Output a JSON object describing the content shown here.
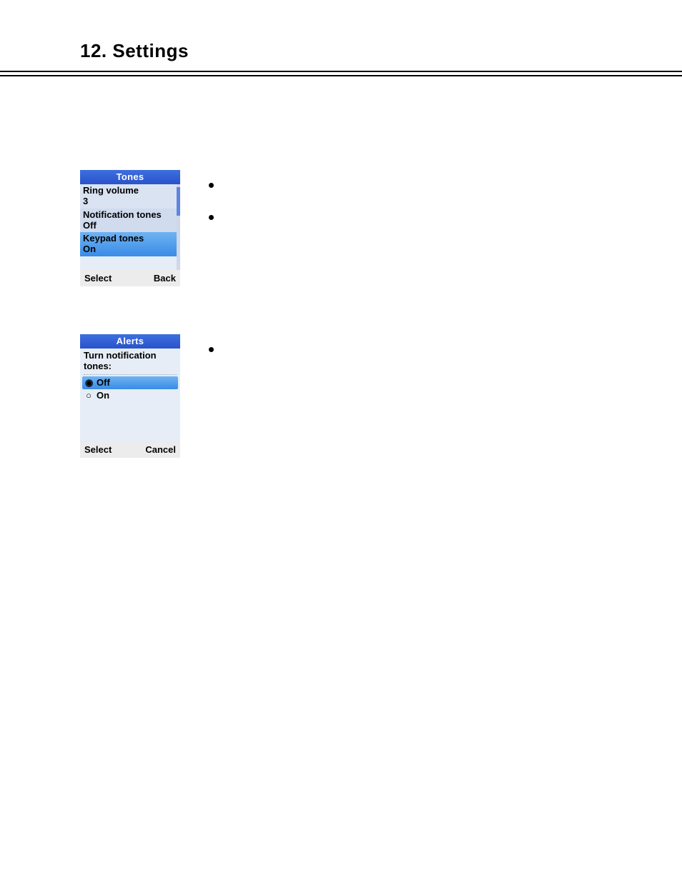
{
  "header": {
    "title": "12. Settings"
  },
  "screen1": {
    "title": "Tones",
    "items": [
      {
        "label": "Ring volume",
        "value": "3"
      },
      {
        "label": "Notification tones",
        "value": "Off"
      },
      {
        "label": "Keypad tones",
        "value": "On"
      }
    ],
    "softkeys": {
      "left": "Select",
      "right": "Back"
    }
  },
  "screen2": {
    "title": "Alerts",
    "prompt": "Turn notification tones:",
    "options": [
      {
        "label": "Off",
        "selected": true
      },
      {
        "label": "On",
        "selected": false
      }
    ],
    "softkeys": {
      "left": "Select",
      "right": "Cancel"
    }
  }
}
